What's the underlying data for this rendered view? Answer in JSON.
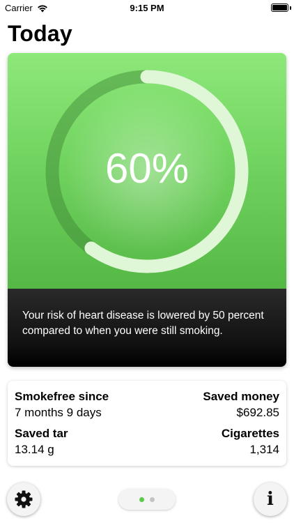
{
  "status_bar": {
    "carrier": "Carrier",
    "time": "9:15 PM"
  },
  "page": {
    "title": "Today"
  },
  "milestone": {
    "percent_label": "60%",
    "progress": 0.6,
    "description": "Your risk of heart disease is lowered by 50 percent compared to when you were still smoking."
  },
  "stats": {
    "smokefree_label": "Smokefree since",
    "smokefree_value": "7 months 9 days",
    "saved_money_label": "Saved money",
    "saved_money_value": "$692.85",
    "saved_tar_label": "Saved tar",
    "saved_tar_value": "13.14 g",
    "cigarettes_label": "Cigarettes",
    "cigarettes_value": "1,314"
  },
  "pager": {
    "total_pages": 2,
    "active_page": 0,
    "active_color": "#5cc94a",
    "inactive_color": "#c4c4c4"
  },
  "icons": {
    "settings": "gear-icon",
    "info": "info-icon",
    "info_glyph": "i"
  },
  "colors": {
    "accent_green": "#6fd35c",
    "card_dark": "#111111"
  }
}
